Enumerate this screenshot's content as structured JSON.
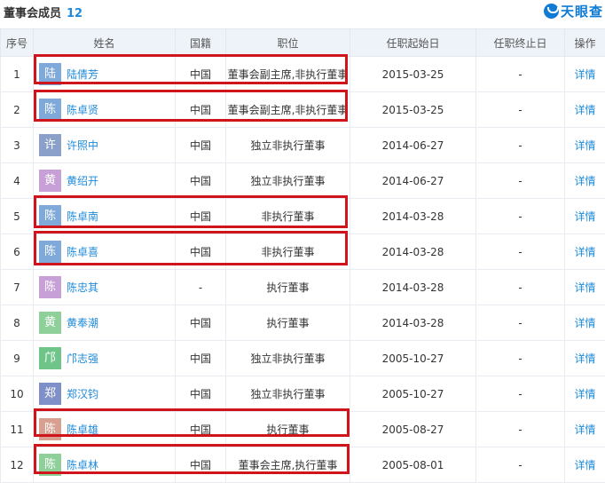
{
  "header": {
    "title": "董事会成员",
    "count": "12",
    "logo_text": "天眼查"
  },
  "columns": {
    "index": "序号",
    "name": "姓名",
    "nationality": "国籍",
    "position": "职位",
    "start": "任职起始日",
    "end": "任职终止日",
    "action": "操作"
  },
  "rows": [
    {
      "index": "1",
      "avatar": "陆",
      "avatar_color": "#7fa9d8",
      "name": "陆倩芳",
      "nationality": "中国",
      "position": "董事会副主席,非执行董事",
      "start": "2015-03-25",
      "end": "-",
      "action": "详情"
    },
    {
      "index": "2",
      "avatar": "陈",
      "avatar_color": "#7fa9d8",
      "name": "陈卓贤",
      "nationality": "中国",
      "position": "董事会副主席,非执行董事",
      "start": "2015-03-25",
      "end": "-",
      "action": "详情"
    },
    {
      "index": "3",
      "avatar": "许",
      "avatar_color": "#8aa0c8",
      "name": "许照中",
      "nationality": "中国",
      "position": "独立非执行董事",
      "start": "2014-06-27",
      "end": "-",
      "action": "详情"
    },
    {
      "index": "4",
      "avatar": "黄",
      "avatar_color": "#c8a0d8",
      "name": "黄绍开",
      "nationality": "中国",
      "position": "独立非执行董事",
      "start": "2014-06-27",
      "end": "-",
      "action": "详情"
    },
    {
      "index": "5",
      "avatar": "陈",
      "avatar_color": "#7fa9d8",
      "name": "陈卓南",
      "nationality": "中国",
      "position": "非执行董事",
      "start": "2014-03-28",
      "end": "-",
      "action": "详情"
    },
    {
      "index": "6",
      "avatar": "陈",
      "avatar_color": "#7fa9d8",
      "name": "陈卓喜",
      "nationality": "中国",
      "position": "非执行董事",
      "start": "2014-03-28",
      "end": "-",
      "action": "详情"
    },
    {
      "index": "7",
      "avatar": "陈",
      "avatar_color": "#c8a0d8",
      "name": "陈忠其",
      "nationality": "-",
      "position": "执行董事",
      "start": "2014-03-28",
      "end": "-",
      "action": "详情"
    },
    {
      "index": "8",
      "avatar": "黄",
      "avatar_color": "#8fcf9a",
      "name": "黄奉潮",
      "nationality": "中国",
      "position": "执行董事",
      "start": "2014-03-28",
      "end": "-",
      "action": "详情"
    },
    {
      "index": "9",
      "avatar": "邝",
      "avatar_color": "#6fc48a",
      "name": "邝志强",
      "nationality": "中国",
      "position": "独立非执行董事",
      "start": "2005-10-27",
      "end": "-",
      "action": "详情"
    },
    {
      "index": "10",
      "avatar": "郑",
      "avatar_color": "#7f8fc8",
      "name": "郑汉钧",
      "nationality": "中国",
      "position": "独立非执行董事",
      "start": "2005-10-27",
      "end": "-",
      "action": "详情"
    },
    {
      "index": "11",
      "avatar": "陈",
      "avatar_color": "#d8a090",
      "name": "陈卓雄",
      "nationality": "中国",
      "position": "执行董事",
      "start": "2005-08-27",
      "end": "-",
      "action": "详情"
    },
    {
      "index": "12",
      "avatar": "陈",
      "avatar_color": "#8fcf9a",
      "name": "陈卓林",
      "nationality": "中国",
      "position": "董事会主席,执行董事",
      "start": "2005-08-01",
      "end": "-",
      "action": "详情"
    }
  ],
  "highlight_color": "#d0141b"
}
